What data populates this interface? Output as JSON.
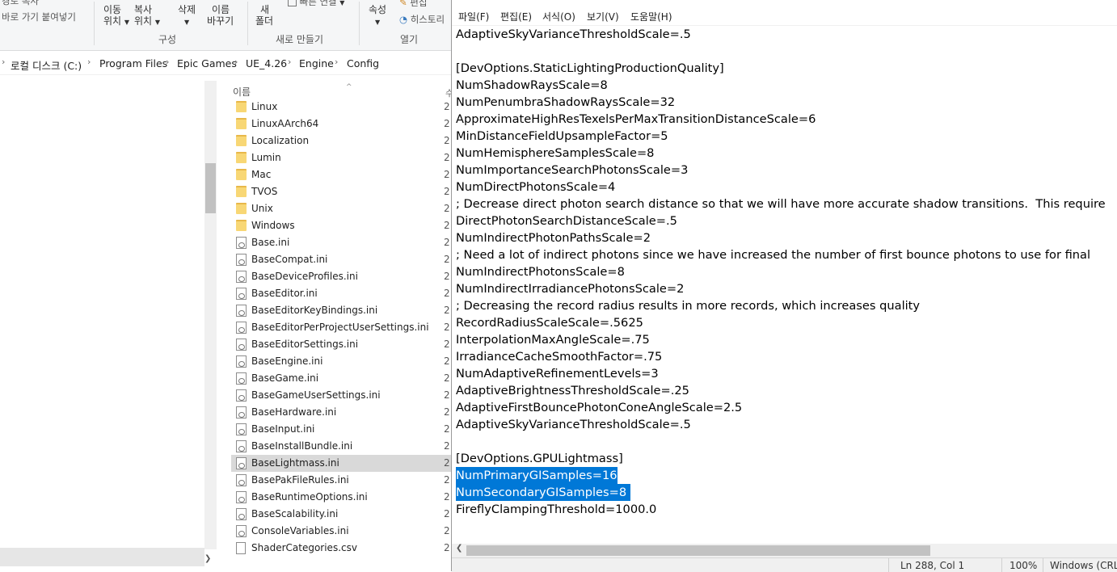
{
  "ribbon": {
    "partial_top": "경로 복사",
    "back": "바로 가기 붙여넣기",
    "move_to": [
      "이동",
      "위치"
    ],
    "copy_to": [
      "복사",
      "위치"
    ],
    "delete": "삭제",
    "rename": [
      "이름",
      "바꾸기"
    ],
    "new_folder": [
      "새",
      "폴더"
    ],
    "new_item": "빠른 연결",
    "properties": "속성",
    "edit": "편집",
    "history": "히스토리",
    "groups": {
      "organize": "구성",
      "new": "새로 만들기",
      "open": "열기"
    }
  },
  "address": {
    "crumbs": [
      "로컬 디스크 (C:)",
      "Program Files",
      "Epic Games",
      "UE_4.26",
      "Engine",
      "Config"
    ]
  },
  "file_list": {
    "column_name": "이름",
    "column_partial": "수",
    "items": [
      {
        "name": "Linux",
        "type": "folder"
      },
      {
        "name": "LinuxAArch64",
        "type": "folder"
      },
      {
        "name": "Localization",
        "type": "folder"
      },
      {
        "name": "Lumin",
        "type": "folder"
      },
      {
        "name": "Mac",
        "type": "folder"
      },
      {
        "name": "TVOS",
        "type": "folder"
      },
      {
        "name": "Unix",
        "type": "folder"
      },
      {
        "name": "Windows",
        "type": "folder"
      },
      {
        "name": "Base.ini",
        "type": "ini"
      },
      {
        "name": "BaseCompat.ini",
        "type": "ini"
      },
      {
        "name": "BaseDeviceProfiles.ini",
        "type": "ini"
      },
      {
        "name": "BaseEditor.ini",
        "type": "ini"
      },
      {
        "name": "BaseEditorKeyBindings.ini",
        "type": "ini"
      },
      {
        "name": "BaseEditorPerProjectUserSettings.ini",
        "type": "ini"
      },
      {
        "name": "BaseEditorSettings.ini",
        "type": "ini"
      },
      {
        "name": "BaseEngine.ini",
        "type": "ini"
      },
      {
        "name": "BaseGame.ini",
        "type": "ini"
      },
      {
        "name": "BaseGameUserSettings.ini",
        "type": "ini"
      },
      {
        "name": "BaseHardware.ini",
        "type": "ini"
      },
      {
        "name": "BaseInput.ini",
        "type": "ini"
      },
      {
        "name": "BaseInstallBundle.ini",
        "type": "ini"
      },
      {
        "name": "BaseLightmass.ini",
        "type": "ini",
        "selected": true
      },
      {
        "name": "BasePakFileRules.ini",
        "type": "ini"
      },
      {
        "name": "BaseRuntimeOptions.ini",
        "type": "ini"
      },
      {
        "name": "BaseScalability.ini",
        "type": "ini"
      },
      {
        "name": "ConsoleVariables.ini",
        "type": "ini"
      },
      {
        "name": "ShaderCategories.csv",
        "type": "csv"
      }
    ],
    "date_prefix": "2"
  },
  "notepad": {
    "menu": [
      "파일(F)",
      "편집(E)",
      "서식(O)",
      "보기(V)",
      "도움말(H)"
    ],
    "lines": [
      {
        "text": "AdaptiveSkyVarianceThresholdScale=.5"
      },
      {
        "text": ""
      },
      {
        "text": "[DevOptions.StaticLightingProductionQuality]"
      },
      {
        "text": "NumShadowRaysScale=8"
      },
      {
        "text": "NumPenumbraShadowRaysScale=32"
      },
      {
        "text": "ApproximateHighResTexelsPerMaxTransitionDistanceScale=6"
      },
      {
        "text": "MinDistanceFieldUpsampleFactor=5"
      },
      {
        "text": "NumHemisphereSamplesScale=8"
      },
      {
        "text": "NumImportanceSearchPhotonsScale=3"
      },
      {
        "text": "NumDirectPhotonsScale=4"
      },
      {
        "text": "; Decrease direct photon search distance so that we will have more accurate shadow transitions.  This require"
      },
      {
        "text": "DirectPhotonSearchDistanceScale=.5"
      },
      {
        "text": "NumIndirectPhotonPathsScale=2"
      },
      {
        "text": "; Need a lot of indirect photons since we have increased the number of first bounce photons to use for final"
      },
      {
        "text": "NumIndirectPhotonsScale=8"
      },
      {
        "text": "NumIndirectIrradiancePhotonsScale=2"
      },
      {
        "text": "; Decreasing the record radius results in more records, which increases quality"
      },
      {
        "text": "RecordRadiusScaleScale=.5625"
      },
      {
        "text": "InterpolationMaxAngleScale=.75"
      },
      {
        "text": "IrradianceCacheSmoothFactor=.75"
      },
      {
        "text": "NumAdaptiveRefinementLevels=3"
      },
      {
        "text": "AdaptiveBrightnessThresholdScale=.25"
      },
      {
        "text": "AdaptiveFirstBouncePhotonConeAngleScale=2.5"
      },
      {
        "text": "AdaptiveSkyVarianceThresholdScale=.5"
      },
      {
        "text": ""
      },
      {
        "text": "[DevOptions.GPULightmass]"
      },
      {
        "text": "NumPrimaryGISamples=16",
        "selected": true
      },
      {
        "text": "NumSecondaryGISamples=8 ",
        "selected": true
      },
      {
        "text": "FireflyClampingThreshold=1000.0"
      }
    ],
    "status": {
      "position": "Ln 288, Col 1",
      "zoom": "100%",
      "line_ending": "Windows (CRLF"
    }
  },
  "colors": {
    "selection": "#0078d7",
    "explorer_selected_row": "#d9d9d9",
    "folder": "#f8d775"
  }
}
